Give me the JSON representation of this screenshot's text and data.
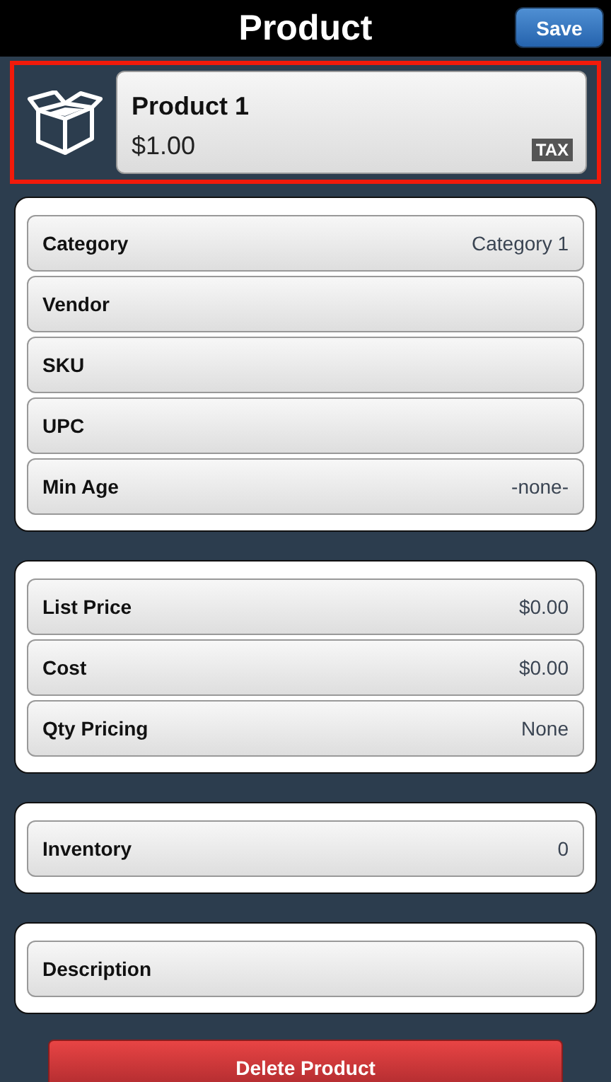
{
  "header": {
    "title": "Product",
    "save_button": "Save"
  },
  "product": {
    "highlighted": true,
    "name": "Product 1",
    "price": "$1.00",
    "badge": "TAX"
  },
  "groups": [
    {
      "rows": [
        {
          "label": "Category",
          "value": "Category 1"
        },
        {
          "label": "Vendor"
        },
        {
          "label": "SKU"
        },
        {
          "label": "UPC"
        },
        {
          "label": "Min Age",
          "value": "-none-"
        }
      ]
    },
    {
      "rows": [
        {
          "label": "List Price",
          "value": "$0.00"
        },
        {
          "label": "Cost",
          "value": "$0.00"
        },
        {
          "label": "Qty Pricing",
          "value": "None"
        }
      ]
    },
    {
      "rows": [
        {
          "label": "Inventory",
          "value": "0"
        }
      ]
    },
    {
      "rows": [
        {
          "label": "Description"
        }
      ]
    }
  ],
  "delete_button": "Delete Product"
}
